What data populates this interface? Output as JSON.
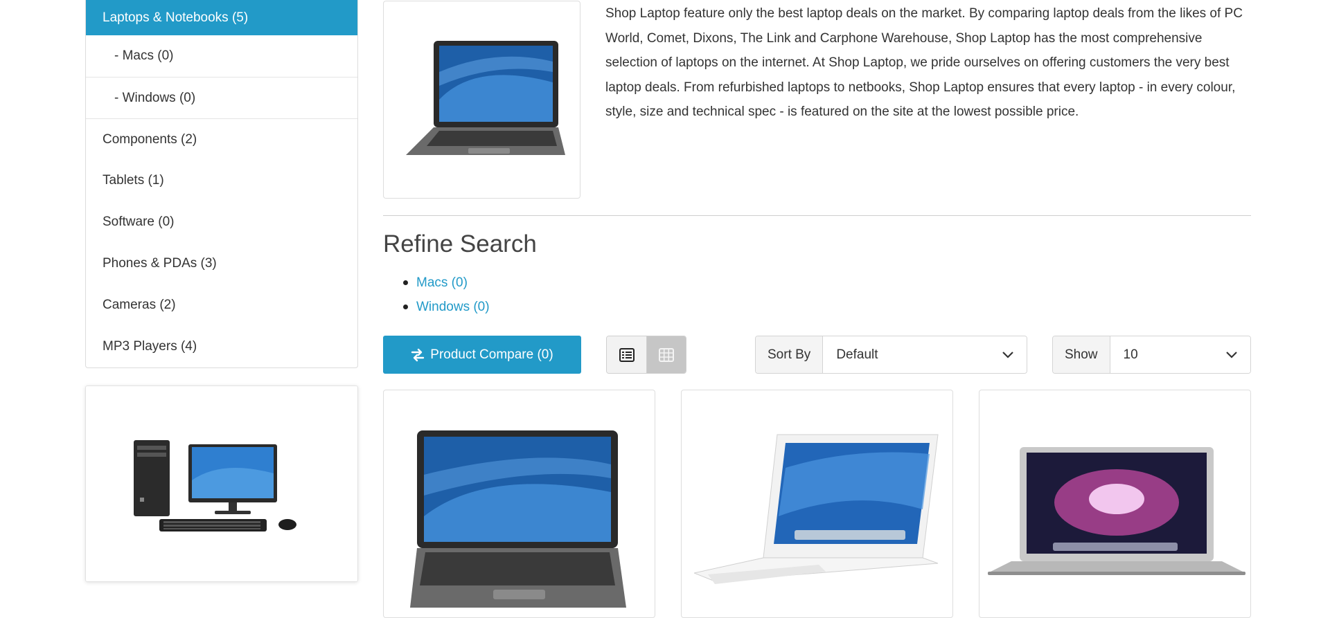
{
  "sidebar": {
    "categories": [
      {
        "label": "Laptops & Notebooks (5)"
      },
      {
        "label": "- Macs (0)"
      },
      {
        "label": "- Windows (0)"
      },
      {
        "label": "Components (2)"
      },
      {
        "label": "Tablets (1)"
      },
      {
        "label": "Software (0)"
      },
      {
        "label": "Phones & PDAs (3)"
      },
      {
        "label": "Cameras (2)"
      },
      {
        "label": "MP3 Players (4)"
      }
    ]
  },
  "main": {
    "description": "Shop Laptop feature only the best laptop deals on the market. By comparing laptop deals from the likes of PC World, Comet, Dixons, The Link and Carphone Warehouse, Shop Laptop has the most comprehensive selection of laptops on the internet. At Shop Laptop, we pride ourselves on offering customers the very best laptop deals. From refurbished laptops to netbooks, Shop Laptop ensures that every laptop - in every colour, style, size and technical spec - is featured on the site at the lowest possible price.",
    "refine_title": "Refine Search",
    "refine_links": [
      "Macs (0)",
      "Windows (0)"
    ],
    "compare_label": "Product Compare (0)",
    "sort_label": "Sort By",
    "sort_value": "Default",
    "show_label": "Show",
    "show_value": "10"
  },
  "colors": {
    "accent": "#229ac8",
    "active_view": "#c6c6c6"
  },
  "icons": [
    "exchange-icon",
    "list-view-icon",
    "grid-view-icon",
    "chevron-down-icon"
  ]
}
